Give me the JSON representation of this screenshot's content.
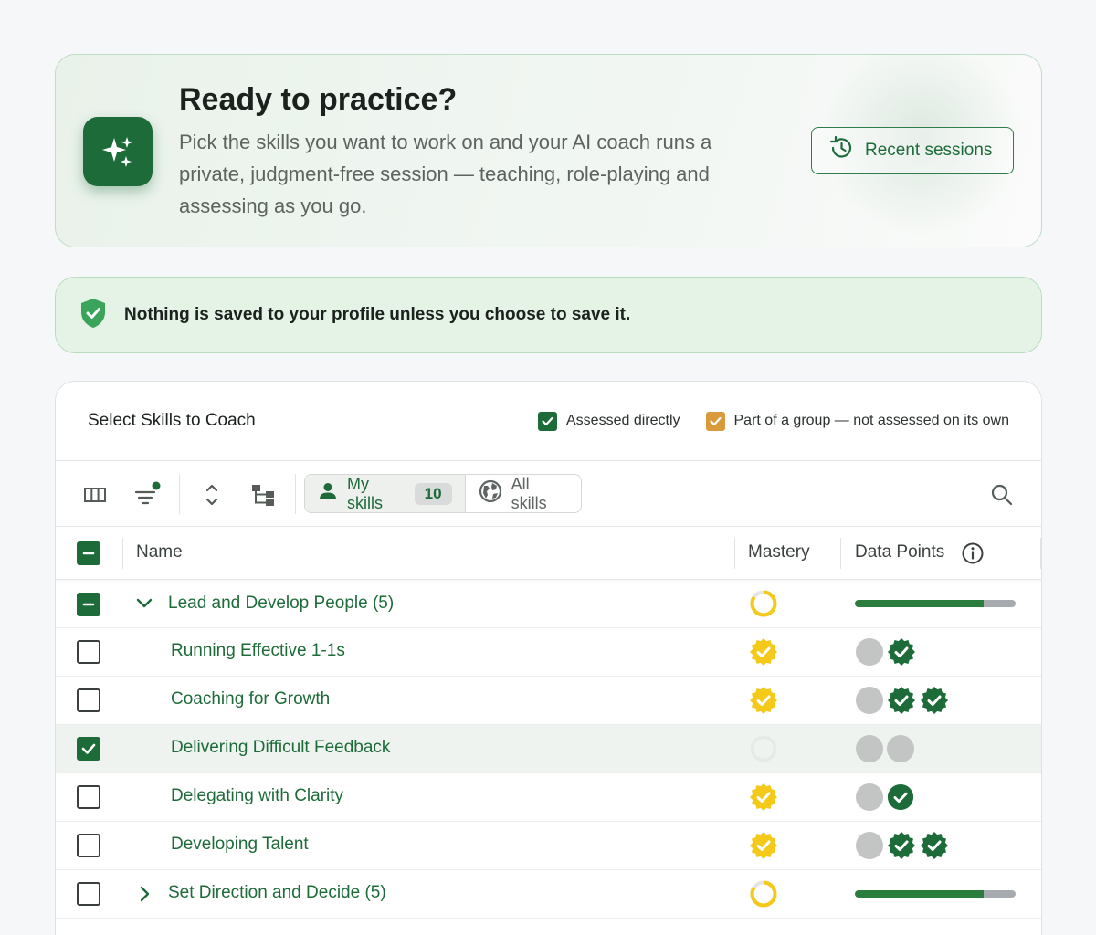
{
  "hero": {
    "title": "Ready to practice?",
    "description": "Pick the skills you want to work on and your AI coach runs a private, judgment-free session — teaching, role-playing and assessing as you go.",
    "recent_sessions_label": "Recent sessions",
    "icon": "sparkles-icon"
  },
  "notice": {
    "text": "Nothing is saved to your profile unless you choose to save it.",
    "icon": "shield-check-icon"
  },
  "panel": {
    "title": "Select Skills to Coach",
    "legend": {
      "assessed_directly": "Assessed directly",
      "part_of_group": "Part of a group — not assessed on its own",
      "assessed_color": "#1e6b3a",
      "group_color": "#d89a3a"
    }
  },
  "toolbar": {
    "my_skills_label": "My skills",
    "my_skills_count": "10",
    "all_skills_label": "All skills"
  },
  "columns": {
    "name": "Name",
    "mastery": "Mastery",
    "data_points": "Data Points"
  },
  "rows": [
    {
      "type": "group",
      "name": "Lead and Develop People (5)",
      "expanded": true,
      "checkbox": "indeterminate",
      "mastery": "partial",
      "data_points_fraction": 0.8
    },
    {
      "type": "skill",
      "name": "Running Effective 1-1s",
      "checkbox": "unchecked",
      "mastery": "badge",
      "data_points": [
        "grey",
        "check-badge"
      ]
    },
    {
      "type": "skill",
      "name": "Coaching for Growth",
      "checkbox": "unchecked",
      "mastery": "badge",
      "data_points": [
        "grey",
        "check-badge",
        "check-badge"
      ]
    },
    {
      "type": "skill",
      "name": "Delivering Difficult Feedback",
      "checkbox": "checked",
      "mastery": "empty",
      "data_points": [
        "grey",
        "grey"
      ]
    },
    {
      "type": "skill",
      "name": "Delegating with Clarity",
      "checkbox": "unchecked",
      "mastery": "badge",
      "data_points": [
        "grey",
        "check-circle"
      ]
    },
    {
      "type": "skill",
      "name": "Developing Talent",
      "checkbox": "unchecked",
      "mastery": "badge",
      "data_points": [
        "grey",
        "check-badge",
        "check-badge"
      ]
    },
    {
      "type": "group",
      "name": "Set Direction and Decide (5)",
      "expanded": false,
      "checkbox": "unchecked",
      "mastery": "partial",
      "data_points_fraction": 0.8
    }
  ]
}
